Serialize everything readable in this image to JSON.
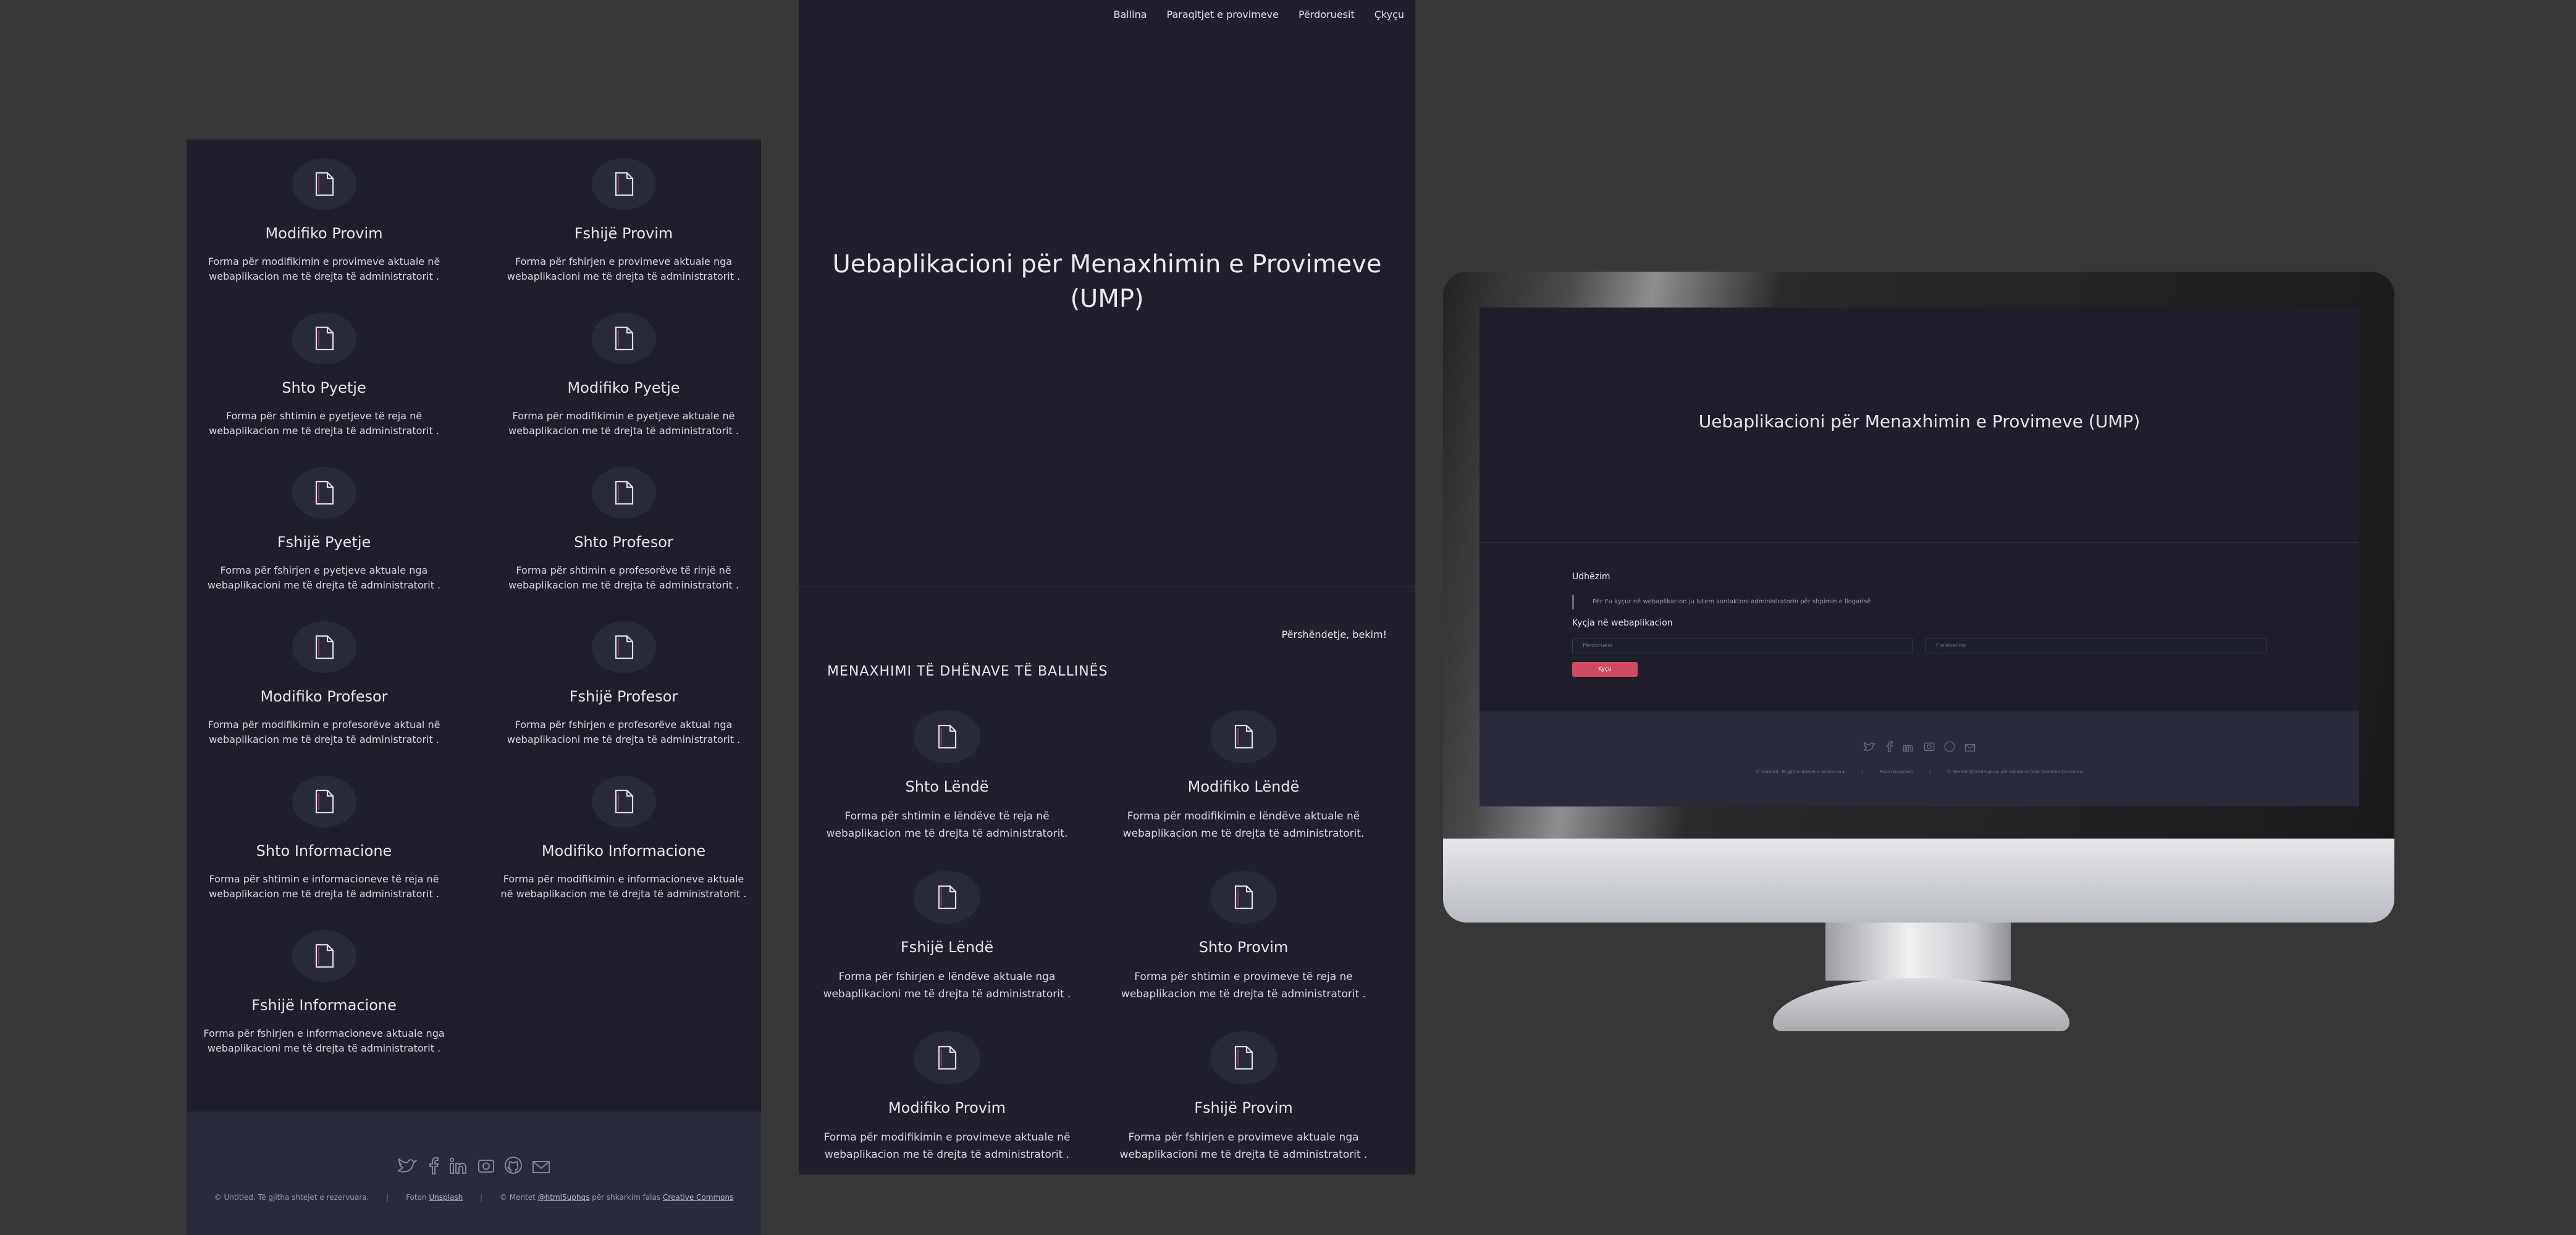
{
  "cards_left": [
    {
      "title": "Modifiko Provim",
      "desc": "Forma për modifikimin e provimeve aktuale në webaplikacion me të drejta të administratorit ."
    },
    {
      "title": "Fshijë Provim",
      "desc": "Forma për fshirjen e provimeve aktuale nga webaplikacioni me të drejta të administratorit ."
    },
    {
      "title": "Shto Pyetje",
      "desc": "Forma për shtimin e pyetjeve të reja në webaplikacion me të drejta të administratorit ."
    },
    {
      "title": "Modifiko Pyetje",
      "desc": "Forma për modifikimin e pyetjeve aktuale në webaplikacion me të drejta të administratorit ."
    },
    {
      "title": "Fshijë Pyetje",
      "desc": "Forma për fshirjen e pyetjeve aktuale nga webaplikacioni me të drejta të administratorit ."
    },
    {
      "title": "Shto Profesor",
      "desc": "Forma për shtimin e profesorëve të rinjë në webaplikacion me të drejta të administratorit ."
    },
    {
      "title": "Modifiko Profesor",
      "desc": "Forma për modifikimin e profesorëve aktual në webaplikacion me të drejta të administratorit ."
    },
    {
      "title": "Fshijë Profesor",
      "desc": "Forma për fshirjen e profesorëve aktual nga webaplikacioni me të drejta të administratorit ."
    },
    {
      "title": "Shto Informacione",
      "desc": "Forma për shtimin e informacioneve të reja në webaplikacion me të drejta të administratorit ."
    },
    {
      "title": "Modifiko Informacione",
      "desc": "Forma për modifikimin e informacioneve aktuale në webaplikacion me të drejta të administratorit ."
    },
    {
      "title": "Fshijë Informacione",
      "desc": "Forma për fshirjen e informacioneve aktuale nga webaplikacioni me të drejta të administratorit ."
    }
  ],
  "footer": {
    "copyright": "© Untitled. Të gjitha shtejet e rezervuara.",
    "photos_prefix": "Foton",
    "photos_link": "Unsplash",
    "design_prefix": "© Mentet",
    "design_link_1": "@html5uphqs",
    "design_mid": "për shkarkim falas",
    "design_link_2": "Creative Commons"
  },
  "nav": [
    "Ballina",
    "Paraqitjet e provimeve",
    "Përdoruesit",
    "Çkyçu"
  ],
  "hero_title_line1": "Uebaplikacioni për Menaxhimin e Provimeve",
  "hero_title_line2": "(UMP)",
  "greeting": "Përshëndetje, bekim!",
  "section_title": "MENAXHIMI TË DHËNAVE TË BALLINËS",
  "cards_mid": [
    {
      "title": "Shto Lëndë",
      "desc": "Forma për shtimin e lëndëve të reja në webaplikacion me të drejta të administratorit."
    },
    {
      "title": "Modifiko Lëndë",
      "desc": "Forma për modifikimin e lëndëve aktuale në webaplikacion me të drejta të administratorit."
    },
    {
      "title": "Fshijë Lëndë",
      "desc": "Forma për fshirjen e lëndëve aktuale nga webaplikacioni me të drejta të administratorit ."
    },
    {
      "title": "Shto Provim",
      "desc": "Forma për shtimin e provimeve të reja ne webaplikacion me të drejta të administratorit ."
    },
    {
      "title": "Modifiko Provim",
      "desc": "Forma për modifikimin e provimeve aktuale në webaplikacion me të drejta të administratorit ."
    },
    {
      "title": "Fshijë Provim",
      "desc": "Forma për fshirjen e provimeve aktuale nga webaplikacioni me të drejta të administratorit ."
    }
  ],
  "screen": {
    "title": "Uebaplikacioni për Menaxhimin e Provimeve (UMP)",
    "guide_label": "Udhëzim",
    "guide_text": "Për t'u kyçur në webaplikacion ju lutem kontaktoni administratorin për shpimin e llogarisë",
    "login_label": "Kyçja në webaplikacion",
    "username_placeholder": "Përdoruesi",
    "password_placeholder": "Fjalëkalimi",
    "login_button": "Kyçu",
    "footer_copyright": "© Untitled. Të gjitha shtejet e rezervuara.",
    "footer_photos": "Foton Unsplash",
    "footer_design": "© Mentet @html5uphqs për shkarkim falas Creative Commons"
  },
  "colors": {
    "page_bg": "#373737",
    "panel_bg": "#1e1f2a",
    "footer_bg": "#2a2b3a",
    "accent_button": "#d04a63"
  },
  "icons": [
    "document-icon",
    "twitter-icon",
    "facebook-icon",
    "linkedin-icon",
    "camera-icon",
    "github-icon",
    "mail-icon"
  ]
}
